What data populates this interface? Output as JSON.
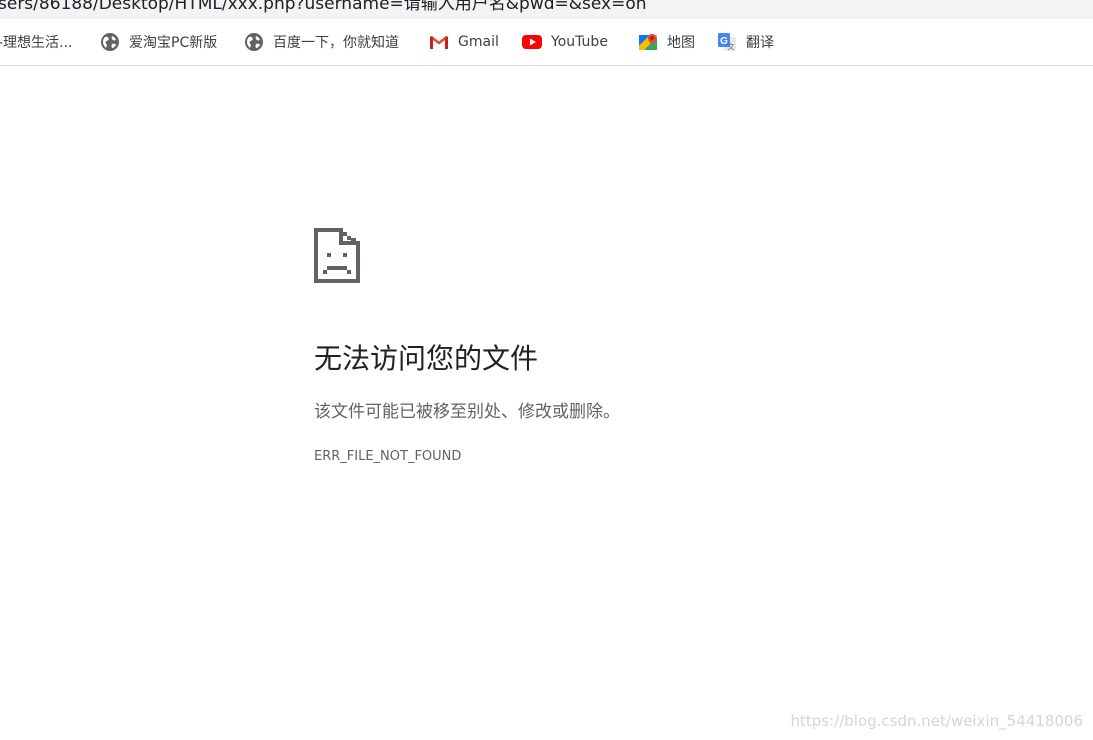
{
  "address_bar": {
    "url": "sers/86188/Desktop/HTML/xxx.php?username=请输入用户名&pwd=&sex=on"
  },
  "bookmarks": [
    {
      "label": "-理想生活...",
      "icon": "none"
    },
    {
      "label": "爱淘宝PC新版",
      "icon": "globe-icon"
    },
    {
      "label": "百度一下，你就知道",
      "icon": "globe-icon"
    },
    {
      "label": "Gmail",
      "icon": "gmail-icon"
    },
    {
      "label": "YouTube",
      "icon": "youtube-icon"
    },
    {
      "label": "地图",
      "icon": "maps-icon"
    },
    {
      "label": "翻译",
      "icon": "translate-icon"
    }
  ],
  "error": {
    "icon": "sad-file-icon",
    "title": "无法访问您的文件",
    "description": "该文件可能已被移至别处、修改或删除。",
    "code": "ERR_FILE_NOT_FOUND"
  },
  "watermark": "https://blog.csdn.net/weixin_54418006",
  "colors": {
    "title": "#202124",
    "secondary_text": "#5f6368",
    "youtube_red": "#ff0000",
    "gmail_red": "#ea4335"
  }
}
